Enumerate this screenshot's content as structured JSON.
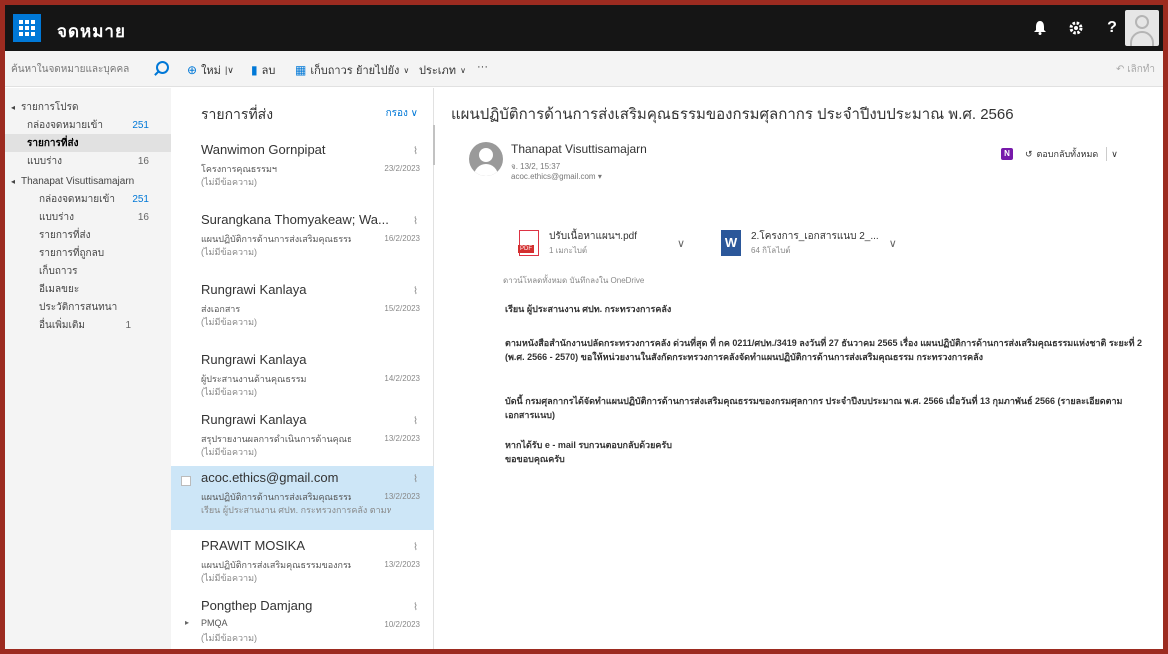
{
  "app": {
    "title": "จดหมาย"
  },
  "topbar": {
    "bell": "🔔",
    "gear": "⚙",
    "help": "?"
  },
  "search": {
    "placeholder": "ค้นหาในจดหมายและบุคคล"
  },
  "commands": {
    "new_label": "ใหม่",
    "delete_label": "ลบ",
    "archive_label": "เก็บถาวร",
    "move_label": "ย้ายไปยัง",
    "categories_label": "ประเภท",
    "more_label": "···",
    "undo_label": "เลิกทำ"
  },
  "nav": {
    "items": [
      {
        "label": "รายการโปรด",
        "count": "",
        "caret": "◂"
      },
      {
        "label": "กล่องจดหมายเข้า",
        "count": "251"
      },
      {
        "label": "รายการที่ส่ง",
        "count": ""
      },
      {
        "label": "แบบร่าง",
        "count": "16"
      },
      {
        "label": "Thanapat Visuttisamajarn",
        "count": "",
        "caret": "◂"
      },
      {
        "label": "กล่องจดหมายเข้า",
        "count": "251"
      },
      {
        "label": "แบบร่าง",
        "count": "16"
      },
      {
        "label": "รายการที่ส่ง",
        "count": ""
      },
      {
        "label": "รายการที่ถูกลบ",
        "count": ""
      },
      {
        "label": "เก็บถาวร",
        "count": ""
      },
      {
        "label": "อีเมลขยะ",
        "count": ""
      },
      {
        "label": "ประวัติการสนทนา",
        "count": ""
      },
      {
        "label": "อื่นเพิ่มเติม",
        "count": "1"
      }
    ]
  },
  "list": {
    "title": "รายการที่ส่ง",
    "filter": "กรอง",
    "messages": [
      {
        "from": "Wanwimon Gornpipat",
        "subject": "โครงการคุณธรรมฯ",
        "preview": "(ไม่มีข้อความ)",
        "date": "23/2/2023"
      },
      {
        "from": "Surangkana Thomyakeaw; Wa...",
        "subject": "แผนปฏิบัติการด้านการส่งเสริมคุณธรรม",
        "preview": "(ไม่มีข้อความ)",
        "date": "16/2/2023"
      },
      {
        "from": "Rungrawi Kanlaya",
        "subject": "ส่งเอกสาร",
        "preview": "(ไม่มีข้อความ)",
        "date": "15/2/2023"
      },
      {
        "from": "Rungrawi Kanlaya",
        "subject": "ผู้ประสานงานด้านคุณธรรม",
        "preview": "(ไม่มีข้อความ)",
        "date": "14/2/2023"
      },
      {
        "from": "Rungrawi Kanlaya",
        "subject": "สรุปรายงานผลการดำเนินการด้านคุณธรรม",
        "preview": "(ไม่มีข้อความ)",
        "date": "13/2/2023"
      },
      {
        "from": "acoc.ethics@gmail.com",
        "subject": "แผนปฏิบัติการด้านการส่งเสริมคุณธรรม",
        "preview": "เรียน ผู้ประสานงาน ศปท. กระทรวงการคลัง ตามหนังสือ...",
        "date": "13/2/2023"
      },
      {
        "from": "PRAWIT MOSIKA",
        "subject": "แผนปฏิบัติการส่งเสริมคุณธรรมของกรมศุลกากร",
        "preview": "(ไม่มีข้อความ)",
        "date": "13/2/2023"
      },
      {
        "from": "Pongthep Damjang",
        "subject": "PMQA",
        "preview": "(ไม่มีข้อความ)",
        "date": "10/2/2023"
      }
    ]
  },
  "reading": {
    "subject": "แผนปฏิบัติการด้านการส่งเสริมคุณธรรมของกรมศุลกากร ประจำปีงบประมาณ พ.ศ. 2566",
    "sender_name": "Thanapat Visuttisamajarn",
    "sender_date": "จ. 13/2, 15:37",
    "sender_email": "acoc.ethics@gmail.com",
    "reply_all_label": "ตอบกลับทั้งหมด",
    "attachments": [
      {
        "name": "ปรับเนื้อหาแผนฯ.pdf",
        "size": "1 เมกะไบต์",
        "type": "pdf"
      },
      {
        "name": "2.โครงการ_เอกสารแนบ 2_...",
        "size": "64 กิโลไบต์",
        "type": "word"
      }
    ],
    "attachment_actions": "ดาวน์โหลดทั้งหมด   บันทึกลงใน OneDrive",
    "greeting": "เรียน ผู้ประสานงาน ศปท. กระทรวงการคลัง",
    "para1": "ตามหนังสือสำนักงานปลัดกระทรวงการคลัง ด่วนที่สุด ที่ กค 0211/ศปท./3419 ลงวันที่ 27 ธันวาคม 2565 เรื่อง แผนปฏิบัติการด้านการส่งเสริมคุณธรรมแห่งชาติ ระยะที่ 2 (พ.ศ. 2566 - 2570) ขอให้หน่วยงานในสังกัดกระทรวงการคลังจัดทำแผนปฏิบัติการด้านการส่งเสริมคุณธรรม กระทรวงการคลัง",
    "para2": "บัดนี้ กรมศุลกากรได้จัดทำแผนปฏิบัติการด้านการส่งเสริมคุณธรรมของกรมศุลกากร ประจำปีงบประมาณ พ.ศ. 2566 เมื่อวันที่ 13 กุมภาพันธ์ 2566 (รายละเอียดตามเอกสารแนบ)",
    "closing1": "หากได้รับ e - mail รบกวนตอบกลับด้วยครับ",
    "closing2": "ขอขอบคุณครับ"
  }
}
